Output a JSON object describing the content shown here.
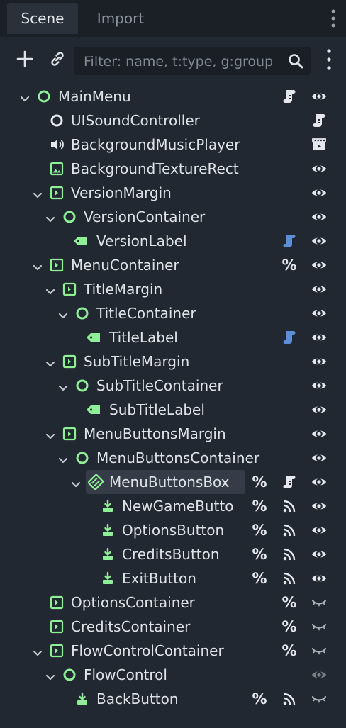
{
  "tabs": [
    {
      "label": "Scene",
      "active": true
    },
    {
      "label": "Import",
      "active": false
    }
  ],
  "toolbar": {
    "add_icon": "plus-icon",
    "link_icon": "link-icon",
    "filter_placeholder": "Filter: name, t:type, g:group",
    "search_icon": "search-icon",
    "menu_icon": "kebab-menu-icon"
  },
  "colors": {
    "background": "#222831",
    "control_green": "#8eef97",
    "script_blue": "#5b8fd6",
    "text": "#dfe3e8"
  },
  "tree": [
    {
      "name": "MainMenu",
      "expanded": true,
      "icon": "node-circle-icon",
      "indicators": [
        "script-icon"
      ],
      "visibility": "visible",
      "selected": false
    },
    {
      "name": "UISoundController",
      "expanded": null,
      "icon": "node-circle-white-icon",
      "indicators": [
        "script-icon"
      ],
      "visibility": null,
      "selected": false
    },
    {
      "name": "BackgroundMusicPlayer",
      "expanded": null,
      "icon": "speaker-icon",
      "indicators": [
        "clapperboard-icon"
      ],
      "visibility": null,
      "selected": false
    },
    {
      "name": "BackgroundTextureRect",
      "expanded": null,
      "icon": "texture-rect-icon",
      "indicators": [],
      "visibility": "visible",
      "selected": false
    },
    {
      "name": "VersionMargin",
      "expanded": true,
      "icon": "margin-container-icon",
      "indicators": [],
      "visibility": "visible",
      "selected": false
    },
    {
      "name": "VersionContainer",
      "expanded": true,
      "icon": "container-circle-icon",
      "indicators": [],
      "visibility": "visible",
      "selected": false
    },
    {
      "name": "VersionLabel",
      "expanded": null,
      "icon": "label-icon",
      "indicators": [
        "script-blue-icon"
      ],
      "visibility": "visible",
      "selected": false
    },
    {
      "name": "MenuContainer",
      "expanded": true,
      "icon": "margin-container-icon",
      "indicators": [
        "unique-name-icon"
      ],
      "visibility": "visible",
      "selected": false
    },
    {
      "name": "TitleMargin",
      "expanded": true,
      "icon": "margin-container-icon",
      "indicators": [],
      "visibility": "visible",
      "selected": false
    },
    {
      "name": "TitleContainer",
      "expanded": true,
      "icon": "container-circle-icon",
      "indicators": [],
      "visibility": "visible",
      "selected": false
    },
    {
      "name": "TitleLabel",
      "expanded": null,
      "icon": "label-icon",
      "indicators": [
        "script-blue-icon"
      ],
      "visibility": "visible",
      "selected": false
    },
    {
      "name": "SubTitleMargin",
      "expanded": true,
      "icon": "margin-container-icon",
      "indicators": [],
      "visibility": "visible",
      "selected": false
    },
    {
      "name": "SubTitleContainer",
      "expanded": true,
      "icon": "container-circle-icon",
      "indicators": [],
      "visibility": "visible",
      "selected": false
    },
    {
      "name": "SubTitleLabel",
      "expanded": null,
      "icon": "label-icon",
      "indicators": [],
      "visibility": "visible",
      "selected": false
    },
    {
      "name": "MenuButtonsMargin",
      "expanded": true,
      "icon": "margin-container-icon",
      "indicators": [],
      "visibility": "visible",
      "selected": false
    },
    {
      "name": "MenuButtonsContainer",
      "expanded": true,
      "icon": "container-circle-icon",
      "indicators": [],
      "visibility": "visible",
      "selected": false
    },
    {
      "name": "MenuButtonsBox",
      "expanded": true,
      "icon": "box-container-icon",
      "indicators": [
        "unique-name-icon",
        "script-icon"
      ],
      "visibility": "visible",
      "selected": true
    },
    {
      "name": "NewGameButto",
      "expanded": null,
      "icon": "button-icon",
      "indicators": [
        "unique-name-icon",
        "signal-icon"
      ],
      "visibility": "visible",
      "selected": false
    },
    {
      "name": "OptionsButton",
      "expanded": null,
      "icon": "button-icon",
      "indicators": [
        "unique-name-icon",
        "signal-icon"
      ],
      "visibility": "visible",
      "selected": false
    },
    {
      "name": "CreditsButton",
      "expanded": null,
      "icon": "button-icon",
      "indicators": [
        "unique-name-icon",
        "signal-icon"
      ],
      "visibility": "visible",
      "selected": false
    },
    {
      "name": "ExitButton",
      "expanded": null,
      "icon": "button-icon",
      "indicators": [
        "unique-name-icon",
        "signal-icon"
      ],
      "visibility": "visible",
      "selected": false
    },
    {
      "name": "OptionsContainer",
      "expanded": null,
      "icon": "margin-container-icon",
      "indicators": [
        "unique-name-icon"
      ],
      "visibility": "hidden",
      "selected": false
    },
    {
      "name": "CreditsContainer",
      "expanded": null,
      "icon": "margin-container-icon",
      "indicators": [
        "unique-name-icon"
      ],
      "visibility": "hidden",
      "selected": false
    },
    {
      "name": "FlowControlContainer",
      "expanded": true,
      "icon": "margin-container-icon",
      "indicators": [
        "unique-name-icon"
      ],
      "visibility": "hidden",
      "selected": false
    },
    {
      "name": "FlowControl",
      "expanded": true,
      "icon": "container-circle-icon",
      "indicators": [],
      "visibility": "dimmed",
      "selected": false
    },
    {
      "name": "BackButton",
      "expanded": null,
      "icon": "button-icon",
      "indicators": [
        "unique-name-icon",
        "signal-icon"
      ],
      "visibility": "hidden",
      "selected": false
    }
  ]
}
